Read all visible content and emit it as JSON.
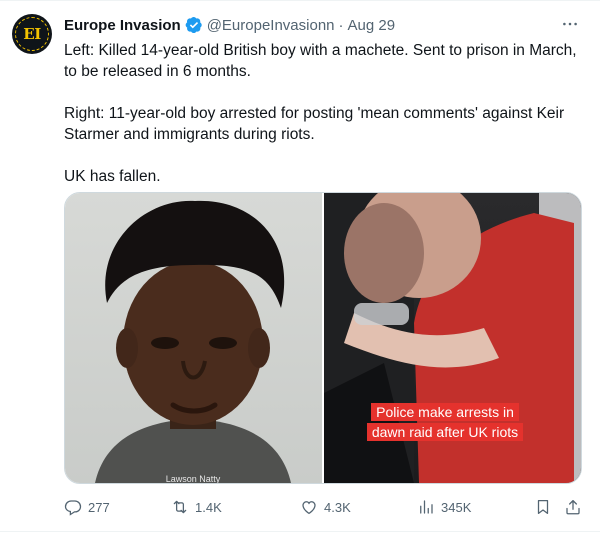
{
  "post": {
    "author": {
      "display_name": "Europe Invasion",
      "handle": "@EuropeInvasionn",
      "date": "Aug 29",
      "separator": "·",
      "avatar_text": "EI",
      "avatar_icon": "europe-invasion-logo"
    },
    "text": {
      "paragraph1": "Left: Killed 14-year-old British boy with a machete. Sent to prison in March, to be released in 6 months.",
      "paragraph2": "Right: 11-year-old boy arrested for posting 'mean comments' against Keir Starmer and immigrants during riots.",
      "paragraph3": "UK has fallen."
    },
    "media": {
      "left_photo_caption": "Lawson Natty",
      "right_photo_caption": "Police make arrests in dawn raid after UK riots",
      "caption_color": "#e5322d"
    },
    "metrics": {
      "replies": "277",
      "reposts": "1.4K",
      "likes": "4.3K",
      "views": "345K"
    },
    "icons": {
      "verified": "verified-badge-icon",
      "more": "more-icon",
      "reply": "reply-icon",
      "repost": "repost-icon",
      "like": "heart-icon",
      "views": "views-icon",
      "bookmark": "bookmark-icon",
      "share": "share-icon"
    },
    "colors": {
      "verified_blue": "#1d9bf0",
      "muted_text": "#536471",
      "primary_text": "#0f1419"
    }
  }
}
